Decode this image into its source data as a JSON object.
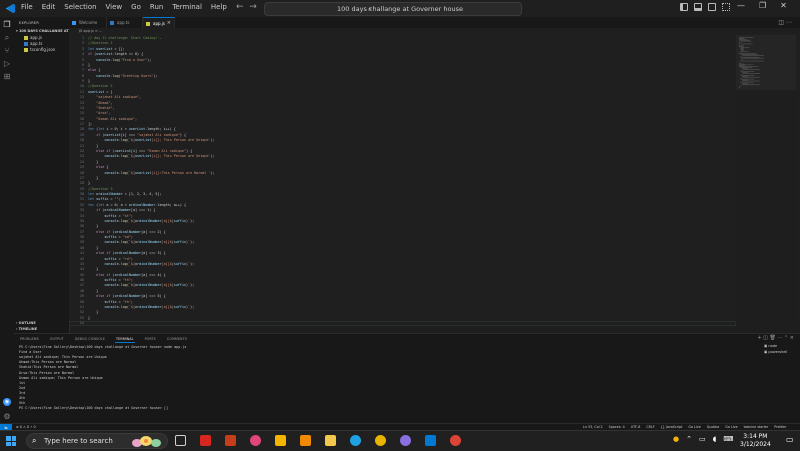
{
  "titlebar": {
    "menu": [
      "File",
      "Edit",
      "Selection",
      "View",
      "Go",
      "Run",
      "Terminal",
      "Help"
    ],
    "command_center": "100 days challange at Governer house"
  },
  "sidebar": {
    "header": "EXPLORER",
    "folder": "100 DAYS CHALLANGE AT GOV...",
    "files": [
      {
        "name": "app.js",
        "color": "#cbcb41"
      },
      {
        "name": "app.ts",
        "color": "#3178c6"
      },
      {
        "name": "tsconfig.json",
        "color": "#cbcb41"
      }
    ],
    "outline": "OUTLINE",
    "timeline": "TIMELINE"
  },
  "tabs": [
    {
      "label": "Welcome",
      "active": false
    },
    {
      "label": "app.ts",
      "active": false
    },
    {
      "label": "app.js",
      "active": true
    }
  ],
  "breadcrumb": "JS app.js > ...",
  "editor": {
    "lines": [
      "// day 11 challenge: Start Coding! ✏",
      "//Question 1",
      "let userList = [];",
      "if (userList.length == 0) {",
      "    console.log(\"Find a User\");",
      "}",
      "else {",
      "    console.log(\"Greeting Users\");",
      "}",
      "//Question 2",
      "userList = [",
      "    \"sajahat Ali sadique\",",
      "    \"Ahmad\",",
      "    \"Shahid\",",
      "    \"Arsa\",",
      "    \"Usman Ali sadique\",",
      "];",
      "for (let i = 0; i < userList.length; i++) {",
      "    if (userList[i] === \"sajahat Ali sadique\") {",
      "        console.log(`${userList[i]}; This Person are Unique`);",
      "    }",
      "    else if (userList[i] === \"Usman Ali sadique\") {",
      "        console.log(`${userList[i]}; This Person are Unique`);",
      "    }",
      "    else {",
      "        console.log(`${userList[i]}:This Person are Normal `);",
      "    }",
      "}",
      "//Question 3",
      "let ordinalNumber = [1, 2, 3, 4, 5];",
      "let suffix = \"\";",
      "for (let a = 0; a < ordinalNumber.length; a++) {",
      "    if (ordinalNumber[a] === 1) {",
      "        suffix = \"st\";",
      "        console.log(`${ordinalNumber[a]}${suffix}`);",
      "    }",
      "    else if (ordinalNumber[a] === 2) {",
      "        suffix = \"nd\";",
      "        console.log(`${ordinalNumber[a]}${suffix}`);",
      "    }",
      "    else if (ordinalNumber[a] === 3) {",
      "        suffix = \"rd\";",
      "        console.log(`${ordinalNumber[a]}${suffix}`);",
      "    }",
      "    else if (ordinalNumber[a] === 4) {",
      "        suffix = \"th\";",
      "        console.log(`${ordinalNumber[a]}${suffix}`);",
      "    }",
      "    else if (ordinalNumber[a] === 5) {",
      "        suffix = \"th\";",
      "        console.log(`${ordinalNumber[a]}${suffix}`);",
      "    }",
      "}",
      ""
    ]
  },
  "panel": {
    "tabs": [
      "PROBLEMS",
      "OUTPUT",
      "DEBUG CONSOLE",
      "TERMINAL",
      "PORTS",
      "COMMENTS"
    ],
    "active_tab": "TERMINAL",
    "terminal_lines": [
      "PS C:\\Users\\Fine Gallery\\Desktop\\100 days challange at Governer house> node app.js",
      "Find a User",
      "sajahat Ali sadique; This Person are Unique",
      "Ahmad:This Person are Normal",
      "Shahid:This Person are Normal",
      "Arsa:This Person are Normal",
      "Usman Ali sadique; This Person are Unique",
      "1st",
      "2nd",
      "3rd",
      "4th",
      "5th",
      "PS C:\\Users\\Fine Gallery\\Desktop\\100 days challange at Governer house> []"
    ],
    "terminal_list": [
      "node",
      "powershell"
    ]
  },
  "statusbar": {
    "left": "⊗ 0 ⚠ 0   ⚡ 0",
    "right": [
      "Ln 53, Col 2",
      "Spaces: 4",
      "UTF-8",
      "CRLF",
      "{} JavaScript",
      "Go Live",
      "Quokka",
      "Go Live",
      "tabnine starter",
      "Prettier"
    ]
  },
  "taskbar": {
    "search_placeholder": "Type here to search",
    "time": "3:14 PM",
    "date": "3/12/2024",
    "icons": [
      {
        "name": "task-view-icon",
        "color": "#d0d0d0"
      },
      {
        "name": "acrobat-icon",
        "color": "#d7261e"
      },
      {
        "name": "powerpoint-icon",
        "color": "#c43e1c"
      },
      {
        "name": "camera-icon",
        "color": "#e0467c"
      },
      {
        "name": "drive-icon",
        "color": "#f4b400"
      },
      {
        "name": "vlc-icon",
        "color": "#f08a00"
      },
      {
        "name": "file-explorer-icon",
        "color": "#f2c94c"
      },
      {
        "name": "edge-icon",
        "color": "#1fa0e0"
      },
      {
        "name": "chrome-icon",
        "color": "#e8b400"
      },
      {
        "name": "app-icon",
        "color": "#8a6fe0"
      },
      {
        "name": "vscode-icon",
        "color": "#0078d4"
      },
      {
        "name": "chrome-icon",
        "color": "#db4437"
      }
    ]
  }
}
